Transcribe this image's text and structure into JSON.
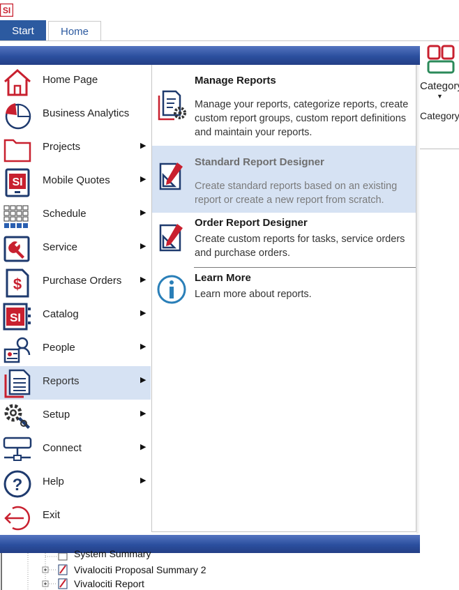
{
  "app": {
    "logo_text": "SI",
    "tabs": [
      {
        "label": "Start"
      },
      {
        "label": "Home"
      }
    ]
  },
  "ribbon": {
    "category_label": "Category",
    "category_label_secondary": "Category"
  },
  "menu": {
    "items": [
      {
        "label": "Home Page",
        "icon": "home-icon",
        "submenu": false
      },
      {
        "label": "Business Analytics",
        "icon": "pie-chart-icon",
        "submenu": false
      },
      {
        "label": "Projects",
        "icon": "folder-icon",
        "submenu": true
      },
      {
        "label": "Mobile Quotes",
        "icon": "si-mobile-icon",
        "submenu": true
      },
      {
        "label": "Schedule",
        "icon": "calendar-grid-icon",
        "submenu": true
      },
      {
        "label": "Service",
        "icon": "wrench-icon",
        "submenu": true
      },
      {
        "label": "Purchase Orders",
        "icon": "dollar-document-icon",
        "submenu": true
      },
      {
        "label": "Catalog",
        "icon": "si-catalog-icon",
        "submenu": true
      },
      {
        "label": "People",
        "icon": "people-icon",
        "submenu": true
      },
      {
        "label": "Reports",
        "icon": "report-document-icon",
        "submenu": true,
        "active": true
      },
      {
        "label": "Setup",
        "icon": "gears-icon",
        "submenu": true
      },
      {
        "label": "Connect",
        "icon": "network-icon",
        "submenu": true
      },
      {
        "label": "Help",
        "icon": "question-icon",
        "submenu": true
      },
      {
        "label": "Exit",
        "icon": "exit-icon",
        "submenu": false
      }
    ]
  },
  "reports_panel": {
    "items": [
      {
        "title": "Manage Reports",
        "description": "Manage your reports, categorize reports, create custom report groups, custom report definitions and maintain your reports.",
        "icon": "manage-reports-icon"
      },
      {
        "title": "Standard Report Designer",
        "description": "Create standard reports based on an existing report or create a new report from scratch.",
        "icon": "report-designer-icon",
        "active": true
      },
      {
        "title": "Order Report Designer",
        "description": "Create custom reports for tasks, service orders and purchase orders.",
        "icon": "order-designer-icon"
      },
      {
        "title": "Learn More",
        "description": "Learn more about reports.",
        "icon": "info-icon"
      }
    ]
  },
  "tree": {
    "rows": [
      {
        "label": "System Summary"
      },
      {
        "label": "Vivalociti Proposal Summary 2"
      },
      {
        "label": "Vivalociti Report"
      }
    ]
  },
  "colors": {
    "accent_blue": "#2c5aa0",
    "brand_red": "#c8202f",
    "icon_navy": "#1e3a6e",
    "icon_teal": "#2a7fb8",
    "active_bg": "#d6e2f3"
  }
}
